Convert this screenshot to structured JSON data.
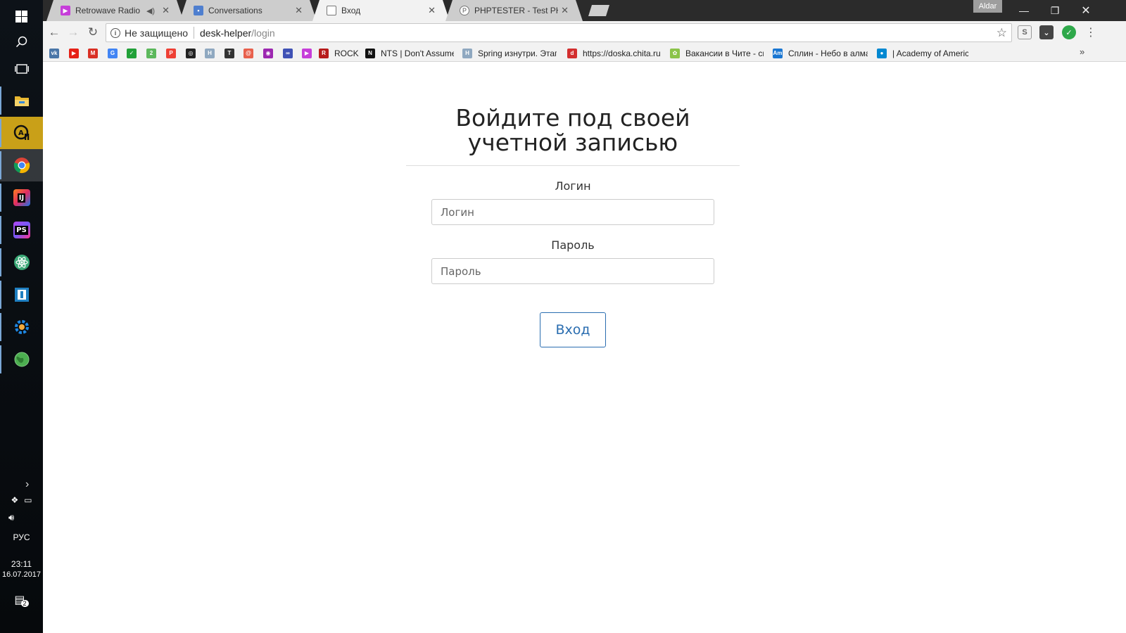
{
  "taskbar": {
    "apps": [
      {
        "name": "file-explorer",
        "glyph": "",
        "color": "#e8b730"
      },
      {
        "name": "audio-player",
        "glyph": "♪",
        "color": "#111"
      },
      {
        "name": "chrome",
        "glyph": "",
        "color": "#db4437"
      },
      {
        "name": "intellij-idea",
        "glyph": "IJ",
        "color": "#1d1d7a"
      },
      {
        "name": "phpstorm",
        "glyph": "PS",
        "color": "#7b2fb5"
      },
      {
        "name": "atom",
        "glyph": "⚛",
        "color": "#3aa876"
      },
      {
        "name": "sourcetree",
        "glyph": "◼",
        "color": "#1f7fc1"
      },
      {
        "name": "settings-gear",
        "glyph": "⚙",
        "color": "#1e88e5"
      },
      {
        "name": "globe",
        "glyph": "●",
        "color": "#4caf50"
      }
    ],
    "tray": {
      "language": "РУС",
      "time": "23:11",
      "date": "16.07.2017",
      "notifications": "2"
    }
  },
  "browser": {
    "profile": "Aldar",
    "tabs": [
      {
        "title": "Retrowave Radio",
        "favicon_color": "#c63ed9",
        "muted_icon": "🔈"
      },
      {
        "title": "Conversations",
        "favicon_color": "#4f7fcf"
      },
      {
        "title": "Вход",
        "favicon_color": "#ffffff"
      },
      {
        "title": "PHPTESTER - Test PHP co",
        "favicon_color": "#555555"
      }
    ],
    "omnibox": {
      "security": "Не защищено",
      "host": "desk-helper",
      "path": "/login"
    },
    "bookmarks": [
      {
        "label": "",
        "color": "#4a76a8",
        "glyph": "vk"
      },
      {
        "label": "",
        "color": "#e62117",
        "glyph": "▶"
      },
      {
        "label": "",
        "color": "#d93025",
        "glyph": "M"
      },
      {
        "label": "",
        "color": "#4285f4",
        "glyph": "G"
      },
      {
        "label": "",
        "color": "#21a038",
        "glyph": "✓"
      },
      {
        "label": "",
        "color": "#5cb85c",
        "glyph": "2"
      },
      {
        "label": "",
        "color": "#ee4035",
        "glyph": "P"
      },
      {
        "label": "",
        "color": "#222222",
        "glyph": "◎"
      },
      {
        "label": "",
        "color": "#8fa8c0",
        "glyph": "H"
      },
      {
        "label": "",
        "color": "#333333",
        "glyph": "T"
      },
      {
        "label": "",
        "color": "#e8604c",
        "glyph": "@"
      },
      {
        "label": "",
        "color": "#9c27b0",
        "glyph": "◉"
      },
      {
        "label": "",
        "color": "#3f51b5",
        "glyph": "∞"
      },
      {
        "label": "",
        "color": "#c63ed9",
        "glyph": "▶"
      },
      {
        "label": "ROCK",
        "color": "#b71c1c",
        "glyph": "R"
      },
      {
        "label": "NTS | Don't Assume",
        "color": "#111111",
        "glyph": "N"
      },
      {
        "label": "Spring изнутри. Этап",
        "color": "#8fa8c0",
        "glyph": "H"
      },
      {
        "label": "https://doska.chita.ru",
        "color": "#d32f2f",
        "glyph": "d"
      },
      {
        "label": "Вакансии в Чите - св",
        "color": "#8bc34a",
        "glyph": "✿"
      },
      {
        "label": "Сплин - Небо в алма",
        "color": "#1976d2",
        "glyph": "Am"
      },
      {
        "label": "| Academy of America",
        "color": "#0288d1",
        "glyph": "●"
      }
    ]
  },
  "login": {
    "heading": "Войдите под своей учетной записью",
    "login_label": "Логин",
    "login_placeholder": "Логин",
    "login_value": "",
    "password_label": "Пароль",
    "password_placeholder": "Пароль",
    "password_value": "",
    "submit_label": "Вход"
  }
}
